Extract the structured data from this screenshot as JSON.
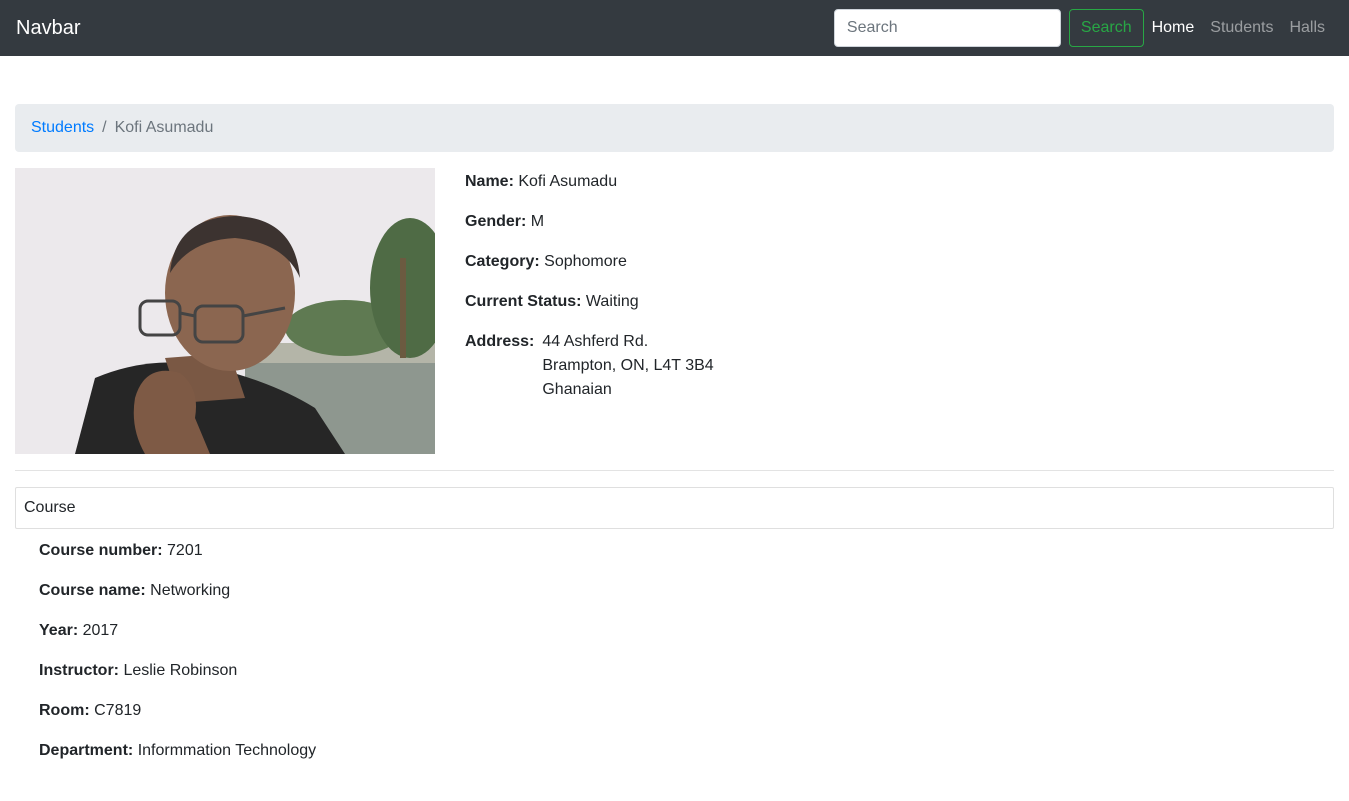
{
  "navbar": {
    "brand": "Navbar",
    "search_placeholder": "Search",
    "search_button": "Search",
    "links": [
      "Home",
      "Students",
      "Halls"
    ]
  },
  "breadcrumb": {
    "parent": "Students",
    "current": "Kofi Asumadu"
  },
  "student": {
    "name_label": "Name:",
    "name": "Kofi Asumadu",
    "gender_label": "Gender:",
    "gender": "M",
    "category_label": "Category:",
    "category": "Sophomore",
    "status_label": "Current Status:",
    "status": "Waiting",
    "address_label": "Address:",
    "address_lines": [
      "44 Ashferd Rd.",
      "Brampton, ON, L4T 3B4",
      "Ghanaian"
    ]
  },
  "course": {
    "header": "Course",
    "number_label": "Course number:",
    "number": "7201",
    "name_label": "Course name:",
    "name": "Networking",
    "year_label": "Year:",
    "year": "2017",
    "instructor_label": "Instructor:",
    "instructor": "Leslie Robinson",
    "room_label": "Room:",
    "room": "C7819",
    "department_label": "Department:",
    "department": "Informmation Technology"
  },
  "colors": {
    "navbar_bg": "#343a40",
    "link": "#007bff",
    "success": "#28a745",
    "breadcrumb_bg": "#e9ecef"
  }
}
